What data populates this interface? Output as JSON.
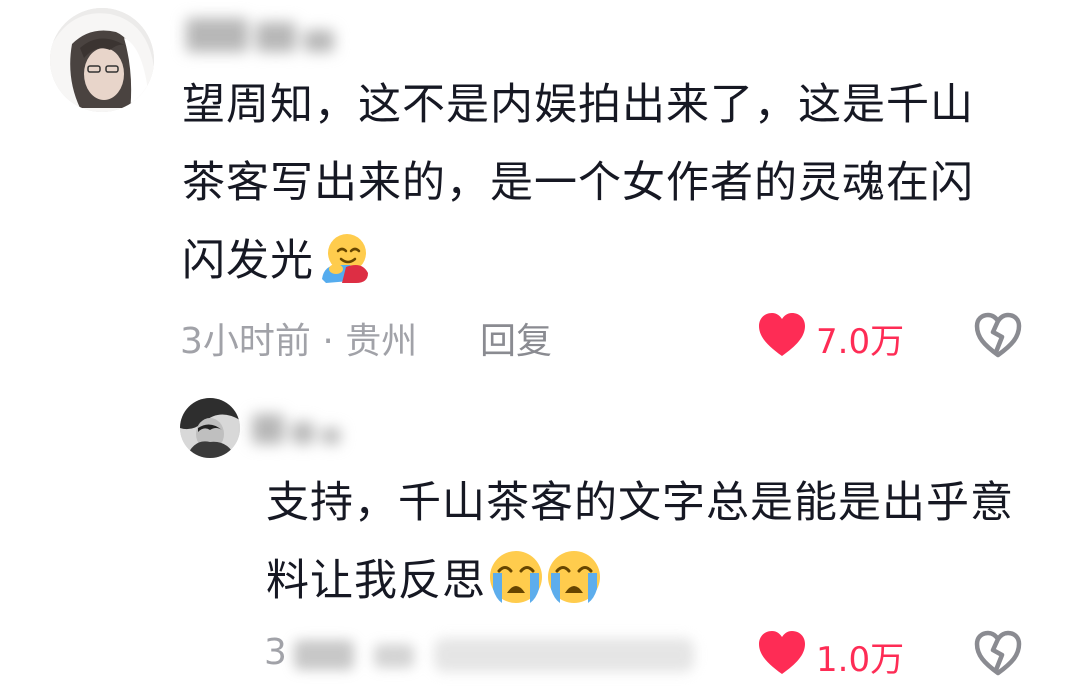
{
  "comments": [
    {
      "avatar_icon": "user-avatar",
      "username": "",
      "text": "望周知，这不是内娱拍出来了，这是千山茶客写出来的，是一个女作者的灵魂在闪闪发光",
      "emoji": "hugging-face-emoji",
      "time_location": "3小时前 · 贵州",
      "reply_label": "回复",
      "like_count": "7.0万",
      "like_color": "#fe2c55"
    },
    {
      "avatar_icon": "user-avatar",
      "username": "",
      "text": "支持，千山茶客的文字总是能是出乎意料让我反思",
      "emoji": "loudly-crying-face-emoji",
      "time_location": "3",
      "reply_label": "",
      "like_count": "1.0万",
      "like_color": "#fe2c55"
    }
  ],
  "icons": {
    "like": "heart-icon",
    "dislike": "broken-heart-icon"
  },
  "colors": {
    "text": "#161823",
    "meta": "#a1a2a8",
    "accent": "#fe2c55",
    "dislike_outline": "#8a8b91"
  }
}
